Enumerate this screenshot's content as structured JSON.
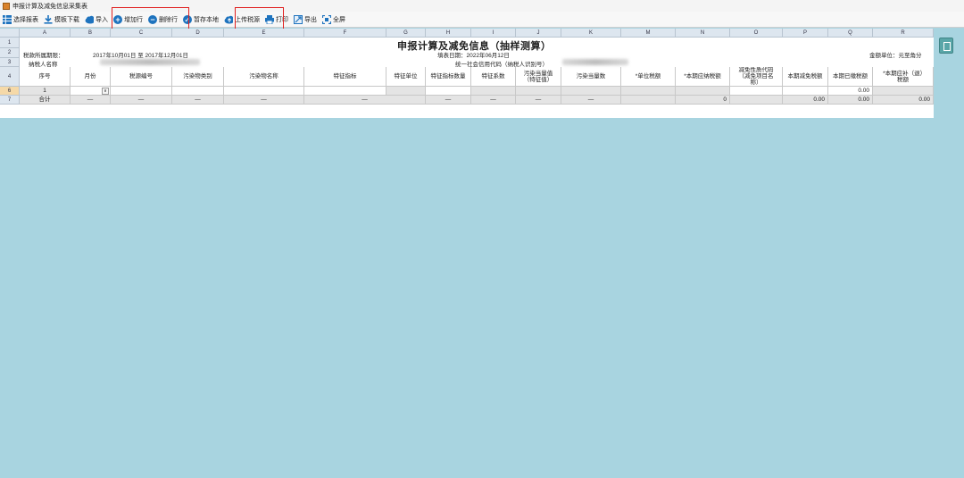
{
  "window": {
    "title": "申报计算及减免信息采集表"
  },
  "toolbar": {
    "select_table": "选择报表",
    "template_download": "模板下载",
    "import": "导入",
    "add_row": "增加行",
    "delete_row": "删除行",
    "save_local": "暂存本地",
    "upload_tax_source": "上传税源",
    "print": "打印",
    "export": "导出",
    "fullscreen": "全屏"
  },
  "columns": [
    "A",
    "B",
    "C",
    "D",
    "E",
    "F",
    "G",
    "H",
    "I",
    "J",
    "K",
    "M",
    "N",
    "O",
    "P",
    "Q",
    "R"
  ],
  "rows": [
    "1",
    "2",
    "3",
    "4",
    "6",
    "7"
  ],
  "form": {
    "title": "申报计算及减免信息（抽样测算）",
    "period_label": "税款所属期限：",
    "period_value": "2017年10月01日 至 2017年12月01日",
    "fill_date": "填表日期：2022年06月12日",
    "amount_unit": "金额单位：元至角分",
    "taxpayer_name_label": "纳税人名称",
    "credit_code_label": "统一社会信用代码（纳税人识别号）"
  },
  "headers": [
    "序号",
    "月份",
    "税源编号",
    "污染物类别",
    "污染物名称",
    "特征指标",
    "特征单位",
    "特征指标数量",
    "特征系数",
    "污染当量值（特征值）",
    "污染当量数",
    "*单位税额",
    "*本期应纳税额",
    "减免性质代码（减免项目名称）",
    "本期减免税额",
    "本期已缴税额",
    "*本期应补（退）税额"
  ],
  "data_row": {
    "index": "1",
    "paid": "0.00"
  },
  "total_row": {
    "label": "合计",
    "dash": "—",
    "tax_payable": "0",
    "reduction": "0.00",
    "paid": "0.00",
    "refund": "0.00"
  },
  "colors": {
    "highlight_box": "#e02020",
    "background": "#a8d4e0"
  },
  "icons": [
    "grid-icon",
    "download-icon",
    "cloud-icon",
    "plus-circle-icon",
    "minus-circle-icon",
    "check-circle-icon",
    "cloud-upload-icon",
    "printer-icon",
    "export-icon",
    "fullscreen-icon"
  ]
}
